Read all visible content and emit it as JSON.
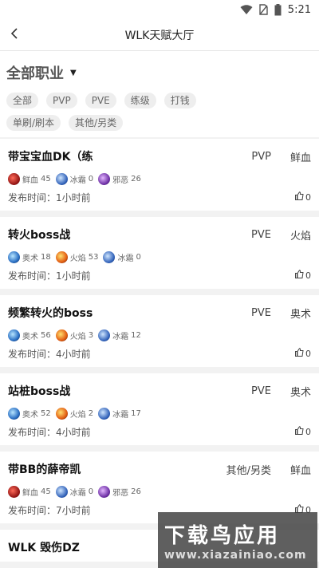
{
  "statusbar": {
    "time": "5:21",
    "icons": [
      "wifi-icon",
      "no-sim-icon",
      "battery-icon"
    ]
  },
  "header": {
    "title": "WLK天赋大厅",
    "back_icon": "chevron-left-icon"
  },
  "filter": {
    "category": "全部职业",
    "tags": [
      "全部",
      "PVP",
      "PVE",
      "练级",
      "打钱",
      "单刷/刷本",
      "其他/另类"
    ]
  },
  "posts": [
    {
      "title": "带宝宝血DK（练",
      "mode": "PVP",
      "spec": "鲜血",
      "talents": [
        {
          "name": "鲜血",
          "points": "45",
          "icon": "blood"
        },
        {
          "name": "冰霜",
          "points": "0",
          "icon": "frost"
        },
        {
          "name": "邪恶",
          "points": "26",
          "icon": "unholy"
        }
      ],
      "time": "发布时间：1小时前",
      "likes": "0"
    },
    {
      "title": "转火boss战",
      "mode": "PVE",
      "spec": "火焰",
      "talents": [
        {
          "name": "奥术",
          "points": "18",
          "icon": "arcane"
        },
        {
          "name": "火焰",
          "points": "53",
          "icon": "fire"
        },
        {
          "name": "冰霜",
          "points": "0",
          "icon": "frost"
        }
      ],
      "time": "发布时间：1小时前",
      "likes": "0"
    },
    {
      "title": "频繁转火的boss",
      "mode": "PVE",
      "spec": "奥术",
      "talents": [
        {
          "name": "奥术",
          "points": "56",
          "icon": "arcane"
        },
        {
          "name": "火焰",
          "points": "3",
          "icon": "fire"
        },
        {
          "name": "冰霜",
          "points": "12",
          "icon": "frost"
        }
      ],
      "time": "发布时间：4小时前",
      "likes": "0"
    },
    {
      "title": "站桩boss战",
      "mode": "PVE",
      "spec": "奥术",
      "talents": [
        {
          "name": "奥术",
          "points": "52",
          "icon": "arcane"
        },
        {
          "name": "火焰",
          "points": "2",
          "icon": "fire"
        },
        {
          "name": "冰霜",
          "points": "17",
          "icon": "frost"
        }
      ],
      "time": "发布时间：4小时前",
      "likes": "0"
    },
    {
      "title": "带BB的薛帝凯",
      "mode": "其他/另类",
      "spec": "鲜血",
      "talents": [
        {
          "name": "鲜血",
          "points": "45",
          "icon": "blood"
        },
        {
          "name": "冰霜",
          "points": "0",
          "icon": "frost"
        },
        {
          "name": "邪恶",
          "points": "26",
          "icon": "unholy"
        }
      ],
      "time": "发布时间：7小时前",
      "likes": "0"
    },
    {
      "title": "WLK 毁伤DZ"
    }
  ],
  "watermark": {
    "line1": "下载鸟应用",
    "line2": "www.xiazainiao.com"
  }
}
